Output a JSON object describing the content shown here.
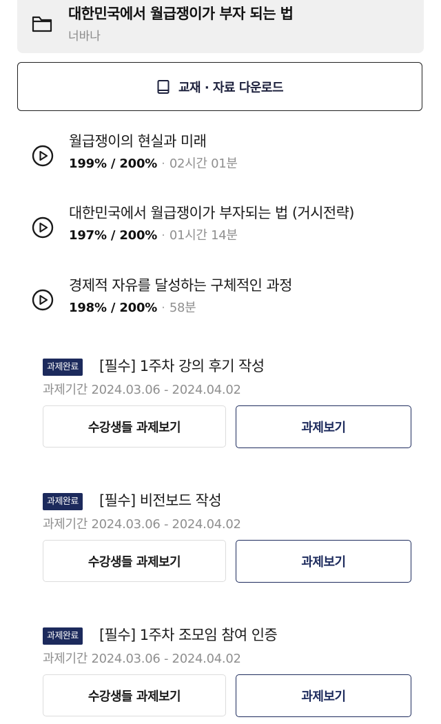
{
  "course": {
    "title": "대한민국에서 월급쟁이가 부자 되는 법",
    "author": "너바나",
    "icon": "folder-icon"
  },
  "download": {
    "label": "교재 · 자료 다운로드",
    "icon": "book-icon"
  },
  "lectures": [
    {
      "title": "월급쟁이의 현실과 미래",
      "progress": "199% / 200%",
      "separator": "·",
      "duration": "02시간 01분"
    },
    {
      "title": "대한민국에서 월급쟁이가 부자되는 법 (거시전략)",
      "progress": "197% / 200%",
      "separator": "·",
      "duration": "01시간 14분"
    },
    {
      "title": "경제적 자유를 달성하는 구체적인 과정",
      "progress": "198% / 200%",
      "separator": "·",
      "duration": "58분"
    }
  ],
  "assignments": [
    {
      "badge": "과제완료",
      "title": "[필수] 1주차 강의 후기 작성",
      "period": "과제기간 2024.03.06 - 2024.04.02",
      "peer_button": "수강생들 과제보기",
      "view_button": "과제보기"
    },
    {
      "badge": "과제완료",
      "title": "[필수] 비전보드 작성",
      "period": "과제기간 2024.03.06 - 2024.04.02",
      "peer_button": "수강생들 과제보기",
      "view_button": "과제보기"
    },
    {
      "badge": "과제완료",
      "title": "[필수] 1주차 조모임 참여 인증",
      "period": "과제기간 2024.03.06 - 2024.04.02",
      "peer_button": "수강생들 과제보기",
      "view_button": "과제보기"
    }
  ],
  "colors": {
    "accent_navy": "#1c2a5c",
    "card_bg": "#f0f0f0",
    "muted_text": "#8f8f8f"
  }
}
